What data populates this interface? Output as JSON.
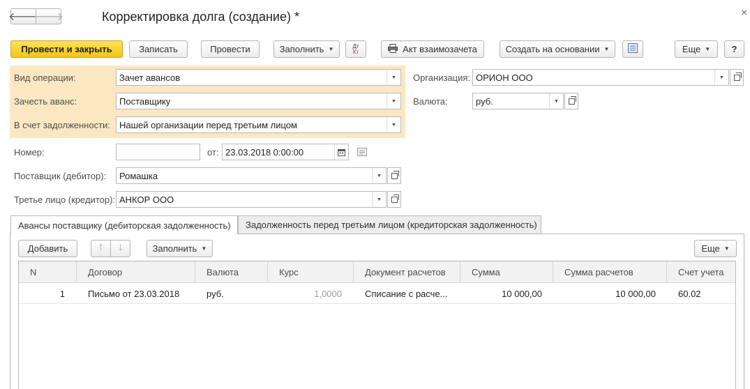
{
  "window": {
    "title": "Корректировка долга (создание) *",
    "close_glyph": "×"
  },
  "nav": {
    "back_glyph": "🡐",
    "forward_glyph": "🡒"
  },
  "toolbar": {
    "post_close": "Провести и закрыть",
    "save": "Записать",
    "post": "Провести",
    "fill": "Заполнить",
    "dtkt_top": "Дт",
    "dtkt_bottom": "Кт",
    "act": "Акт взаимозачета",
    "create_based": "Создать на основании",
    "more": "Еще",
    "help": "?"
  },
  "form": {
    "operation_type": {
      "label": "Вид операции:",
      "value": "Зачет авансов"
    },
    "offset_advance": {
      "label": "Зачесть аванс:",
      "value": "Поставщику"
    },
    "debt_account": {
      "label": "В счет задолженности:",
      "value": "Нашей организации перед третьим лицом"
    },
    "organization": {
      "label": "Организация:",
      "value": "ОРИОН ООО"
    },
    "currency": {
      "label": "Валюта:",
      "value": "руб."
    },
    "number": {
      "label": "Номер:",
      "value": ""
    },
    "date": {
      "label": "от:",
      "value": "23.03.2018  0:00:00"
    },
    "supplier": {
      "label": "Поставщик (дебитор):",
      "value": "Ромашка"
    },
    "third_party": {
      "label": "Третье лицо (кредитор):",
      "value": "АНКОР ООО"
    }
  },
  "tabs": [
    {
      "label": "Авансы поставщику (дебиторская задолженность)",
      "active": true
    },
    {
      "label": "Задолженность перед третьим лицом (кредиторская задолженность)",
      "active": false
    }
  ],
  "table_toolbar": {
    "add": "Добавить",
    "fill": "Заполнить",
    "more": "Еще"
  },
  "table": {
    "columns": [
      "N",
      "Договор",
      "Валюта",
      "Курс",
      "Документ расчетов",
      "Сумма",
      "Сумма расчетов",
      "Счет учета"
    ],
    "rows": [
      {
        "n": "1",
        "contract": "Письмо от 23.03.2018",
        "currency": "руб.",
        "rate": "1,0000",
        "doc": "Списание с расче...",
        "sum": "10 000,00",
        "settle_sum": "10 000,00",
        "account": "60.02"
      }
    ]
  },
  "colors": {
    "primary_button": "#f4c514",
    "highlight_bg": "#fbe8c2",
    "border": "#b8b8b8"
  }
}
